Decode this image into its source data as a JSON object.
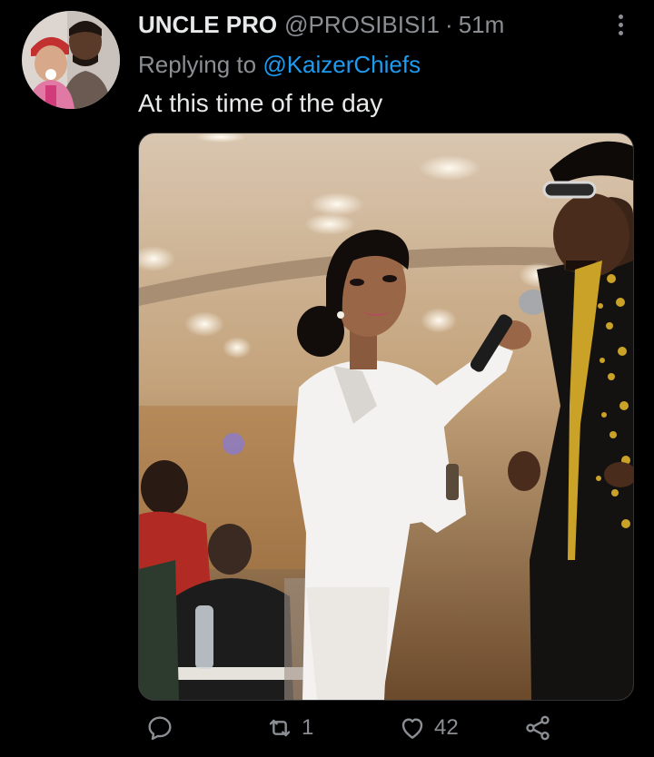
{
  "tweet": {
    "display_name": "UNCLE PRO",
    "handle": "@PROSIBISI1",
    "separator": "·",
    "time": "51m",
    "replying_prefix": "Replying to ",
    "replying_to": "@KaizerChiefs",
    "text": "At this time of the day"
  },
  "actions": {
    "reply_count": "",
    "retweet_count": "1",
    "like_count": "42"
  },
  "icons": {
    "reply": "reply-icon",
    "retweet": "retweet-icon",
    "like": "heart-icon",
    "share": "share-icon",
    "more": "more-options-icon"
  },
  "colors": {
    "background": "#000000",
    "primary_text": "#e7e9ea",
    "secondary_text": "#8b8f94",
    "accent": "#1d9bf0"
  }
}
